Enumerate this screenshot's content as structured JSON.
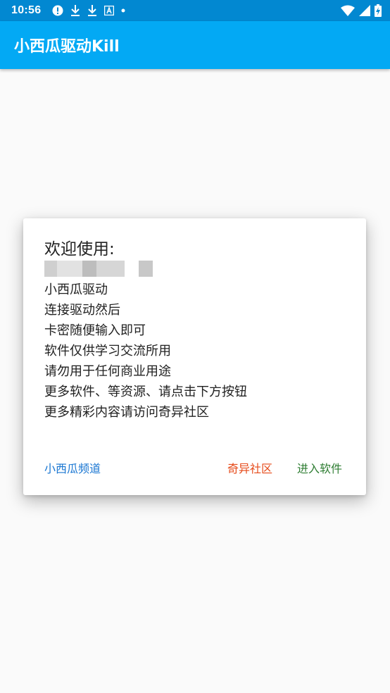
{
  "status_bar": {
    "time": "10:56",
    "icons_left": [
      "alert-icon",
      "download-icon",
      "download-icon",
      "keyboard-a-icon",
      "dot-icon"
    ],
    "icons_right": [
      "wifi-icon",
      "signal-icon",
      "battery-charging-icon"
    ]
  },
  "app_bar": {
    "title": "小西瓜驱动Kill",
    "color": "#03a9f4"
  },
  "dialog": {
    "title": "欢迎使用:",
    "redacted_line": "(blurred text)",
    "lines": [
      "小西瓜驱动",
      "连接驱动然后",
      "卡密随便输入即可",
      "软件仅供学习交流所用",
      "请勿用于任何商业用途",
      "更多软件、等资源、请点击下方按钮",
      "更多精彩内容请访问奇异社区"
    ],
    "actions": {
      "neutral": "小西瓜频道",
      "negative": "奇异社区",
      "positive": "进入软件"
    }
  }
}
